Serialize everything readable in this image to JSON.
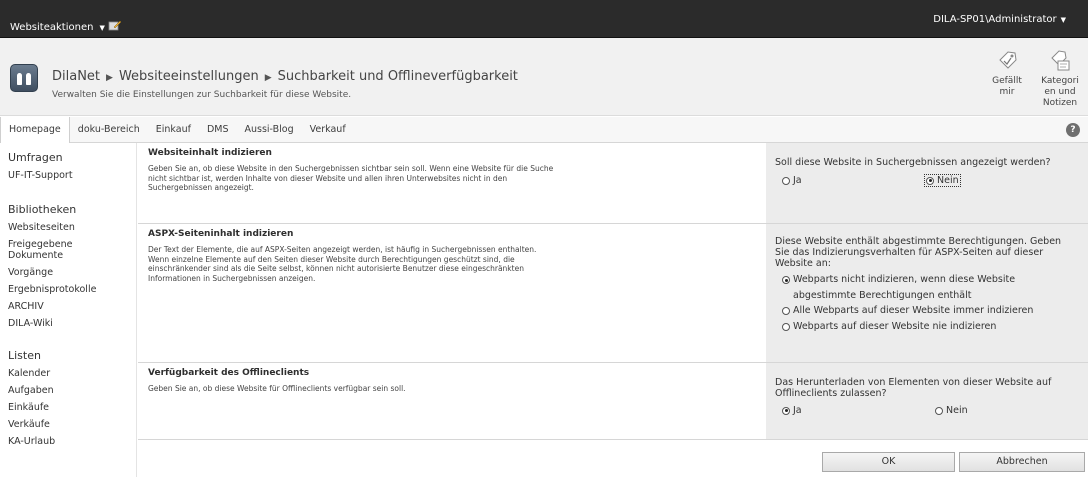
{
  "ribbon": {
    "site_actions": "Websiteaktionen",
    "user": "DILA-SP01\\Administrator"
  },
  "title": {
    "site": "DilaNet",
    "crumb1": "Websiteeinstellungen",
    "crumb2": "Suchbarkeit und Offlineverfügbarkeit",
    "subtitle": "Verwalten Sie die Einstellungen zur Suchbarkeit für diese Website."
  },
  "social": {
    "like_line1": "Gefällt",
    "like_line2": "mir",
    "tags_line1": "Kategori",
    "tags_line2": "en und",
    "tags_line3": "Notizen"
  },
  "topnav": [
    "Homepage",
    "doku-Bereich",
    "Einkauf",
    "DMS",
    "Aussi-Blog",
    "Verkauf"
  ],
  "help": "?",
  "leftnav": {
    "umfragen": "Umfragen",
    "uf_it": "UF-IT-Support",
    "bibliotheken": "Bibliotheken",
    "websiteseiten": "Websiteseiten",
    "freigegebene1": "Freigegebene",
    "freigegebene2": "Dokumente",
    "vorgaenge": "Vorgänge",
    "ergebnis": "Ergebnisprotokolle",
    "archiv": "ARCHIV",
    "dilawiki": "DILA-Wiki",
    "listen": "Listen",
    "kalender": "Kalender",
    "aufgaben": "Aufgaben",
    "einkaeufe": "Einkäufe",
    "verkaeufe": "Verkäufe",
    "kaurlaub": "KA-Urlaub"
  },
  "sections": {
    "s1": {
      "heading": "Websiteinhalt indizieren",
      "text": "Geben Sie an, ob diese Website in den Suchergebnissen sichtbar sein soll. Wenn eine Website für die Suche nicht sichtbar ist, werden Inhalte von dieser Website und allen ihren Unterwebsites nicht in den Suchergebnissen angezeigt.",
      "question": "Soll diese Website in Suchergebnissen angezeigt werden?",
      "opt_ja": "Ja",
      "opt_nein": "Nein"
    },
    "s2": {
      "heading": "ASPX-Seiteninhalt indizieren",
      "text": "Der Text der Elemente, die auf ASPX-Seiten angezeigt werden, ist häufig in Suchergebnissen enthalten. Wenn einzelne Elemente auf den Seiten dieser Website durch Berechtigungen geschützt sind, die einschränkender sind als die Seite selbst, können nicht autorisierte Benutzer diese eingeschränkten Informationen in Suchergebnissen anzeigen.",
      "question": "Diese Website enthält abgestimmte Berechtigungen. Geben Sie das Indizierungsverhalten für ASPX-Seiten auf dieser Website an:",
      "opt1": "Webparts nicht indizieren, wenn diese Website abgestimmte Berechtigungen enthält",
      "opt2": "Alle Webparts auf dieser Website immer indizieren",
      "opt3": "Webparts auf dieser Website nie indizieren"
    },
    "s3": {
      "heading": "Verfügbarkeit des Offlineclients",
      "text": "Geben Sie an, ob diese Website für Offlineclients verfügbar sein soll.",
      "question": "Das Herunterladen von Elementen von dieser Website auf Offlineclients zulassen?",
      "opt_ja": "Ja",
      "opt_nein": "Nein"
    }
  },
  "buttons": {
    "ok": "OK",
    "cancel": "Abbrechen"
  }
}
